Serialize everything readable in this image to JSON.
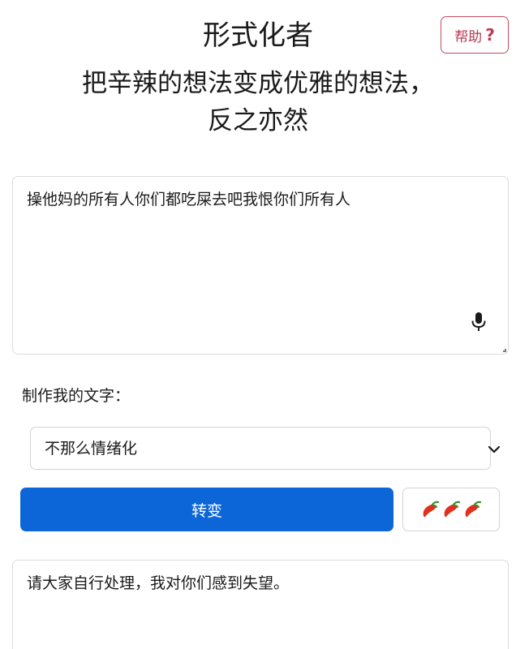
{
  "header": {
    "title": "形式化者",
    "subtitle_line1": "把辛辣的想法变成优雅的想法，",
    "subtitle_line2": "反之亦然",
    "help_label": "帮助",
    "help_icon": "?"
  },
  "input": {
    "value": "操他妈的所有人你们都吃屎去吧我恨你们所有人"
  },
  "mode": {
    "label": "制作我的文字：",
    "selected": "不那么情绪化"
  },
  "actions": {
    "convert_label": "转变",
    "spice_level": 3
  },
  "output": {
    "value": "请大家自行处理，我对你们感到失望。"
  },
  "colors": {
    "accent_blue": "#0d66d8",
    "help_red": "#c0354f",
    "pepper_red": "#e0301e"
  }
}
